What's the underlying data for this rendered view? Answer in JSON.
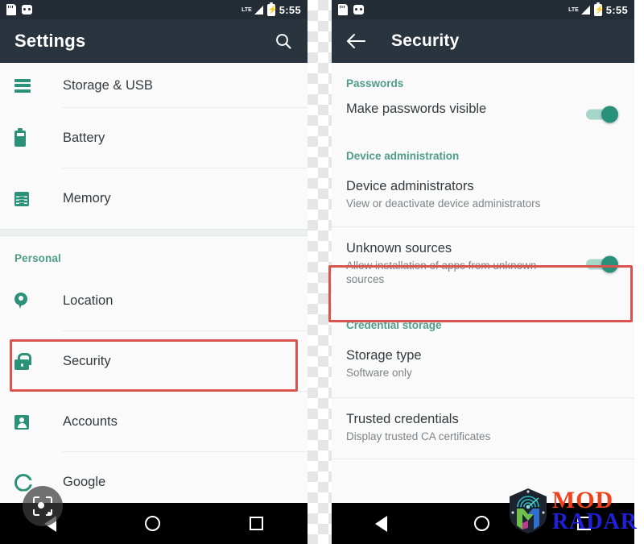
{
  "status_bar": {
    "icons": [
      "sdcard-icon",
      "usb-icon",
      "lte-signal-icon",
      "battery-charging-icon"
    ],
    "network_label": "LTE",
    "time": "5:55"
  },
  "colors": {
    "toolbar_bg": "#29343f",
    "status_bg": "#242c35",
    "accent_green": "#2c9179",
    "section_header": "#4e9c89",
    "highlight_red": "#d9534f",
    "toggle_on_thumb": "#29907a",
    "toggle_on_track": "#a6d6ca",
    "navbar_bg": "#000000"
  },
  "left_panel": {
    "toolbar": {
      "title": "Settings",
      "search_icon": "search-icon"
    },
    "rows": [
      {
        "label": "Storage & USB",
        "icon": "storage-icon"
      },
      {
        "label": "Battery",
        "icon": "battery-icon"
      },
      {
        "label": "Memory",
        "icon": "memory-icon"
      }
    ],
    "personal_header": "Personal",
    "personal_rows": [
      {
        "label": "Location",
        "icon": "location-pin-icon"
      },
      {
        "label": "Security",
        "icon": "lock-icon",
        "highlighted": true
      },
      {
        "label": "Accounts",
        "icon": "person-icon"
      },
      {
        "label": "Google",
        "icon": "google-icon"
      }
    ],
    "nav": {
      "back": "back-triangle-icon",
      "home": "home-circle-icon",
      "recents": "recents-square-icon"
    },
    "lens_button": "google-lens-icon"
  },
  "right_panel": {
    "toolbar": {
      "back_icon": "back-arrow-icon",
      "title": "Security"
    },
    "sections": [
      {
        "header": "Passwords",
        "items": [
          {
            "title": "Make passwords visible",
            "subtitle": "",
            "toggle": "on",
            "highlighted": false
          }
        ]
      },
      {
        "header": "Device administration",
        "items": [
          {
            "title": "Device administrators",
            "subtitle": "View or deactivate device administrators",
            "toggle": "none",
            "highlighted": false
          },
          {
            "title": "Unknown sources",
            "subtitle": "Allow installation of apps from unknown sources",
            "toggle": "on",
            "highlighted": true
          }
        ]
      },
      {
        "header": "Credential storage",
        "items": [
          {
            "title": "Storage type",
            "subtitle": "Software only",
            "toggle": "none",
            "highlighted": false
          },
          {
            "title": "Trusted credentials",
            "subtitle": "Display trusted CA certificates",
            "toggle": "none",
            "highlighted": false
          }
        ]
      }
    ],
    "nav": {
      "back": "back-triangle-icon",
      "home": "home-circle-icon",
      "recents": "recents-square-icon"
    }
  },
  "watermark": {
    "line1": "MOD",
    "line2": "RADAR",
    "logo": "mod-radar-shield-icon"
  }
}
